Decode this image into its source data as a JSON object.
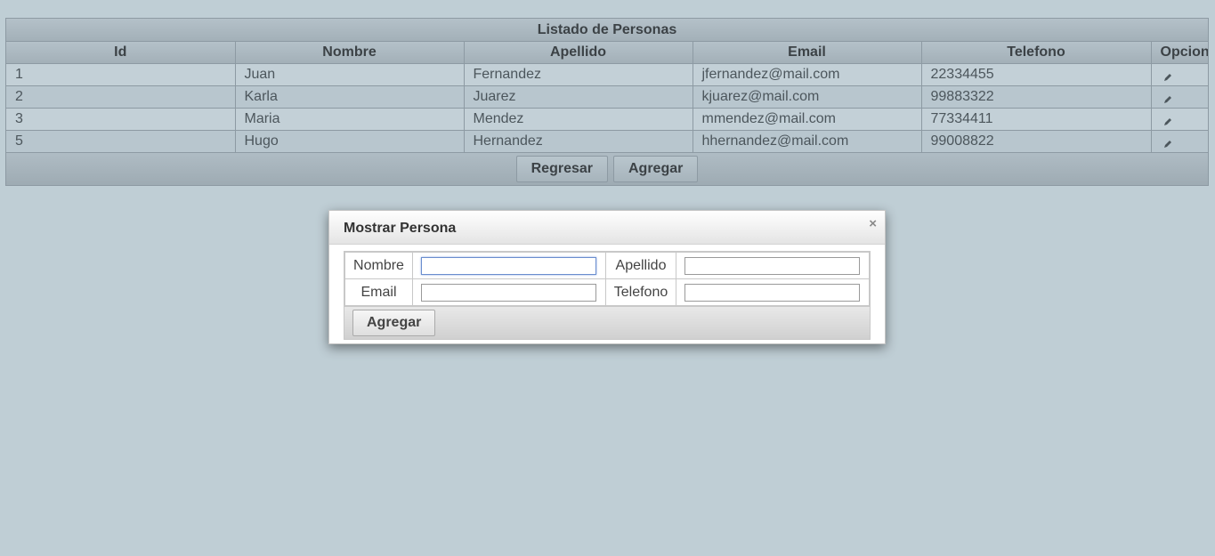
{
  "list": {
    "caption": "Listado de Personas",
    "columns": [
      "Id",
      "Nombre",
      "Apellido",
      "Email",
      "Telefono",
      "Opcion"
    ],
    "rows": [
      {
        "id": "1",
        "nombre": "Juan",
        "apellido": "Fernandez",
        "email": "jfernandez@mail.com",
        "telefono": "22334455"
      },
      {
        "id": "2",
        "nombre": "Karla",
        "apellido": "Juarez",
        "email": "kjuarez@mail.com",
        "telefono": "99883322"
      },
      {
        "id": "3",
        "nombre": "Maria",
        "apellido": "Mendez",
        "email": "mmendez@mail.com",
        "telefono": "77334411"
      },
      {
        "id": "5",
        "nombre": "Hugo",
        "apellido": "Hernandez",
        "email": "hhernandez@mail.com",
        "telefono": "99008822"
      }
    ],
    "buttons": {
      "back": "Regresar",
      "add": "Agregar"
    },
    "edit_icon": "pencil-icon"
  },
  "dialog": {
    "title": "Mostrar Persona",
    "close_glyph": "×",
    "fields": {
      "nombre_label": "Nombre",
      "nombre_value": "",
      "apellido_label": "Apellido",
      "apellido_value": "",
      "email_label": "Email",
      "email_value": "",
      "telefono_label": "Telefono",
      "telefono_value": ""
    },
    "submit_label": "Agregar"
  }
}
